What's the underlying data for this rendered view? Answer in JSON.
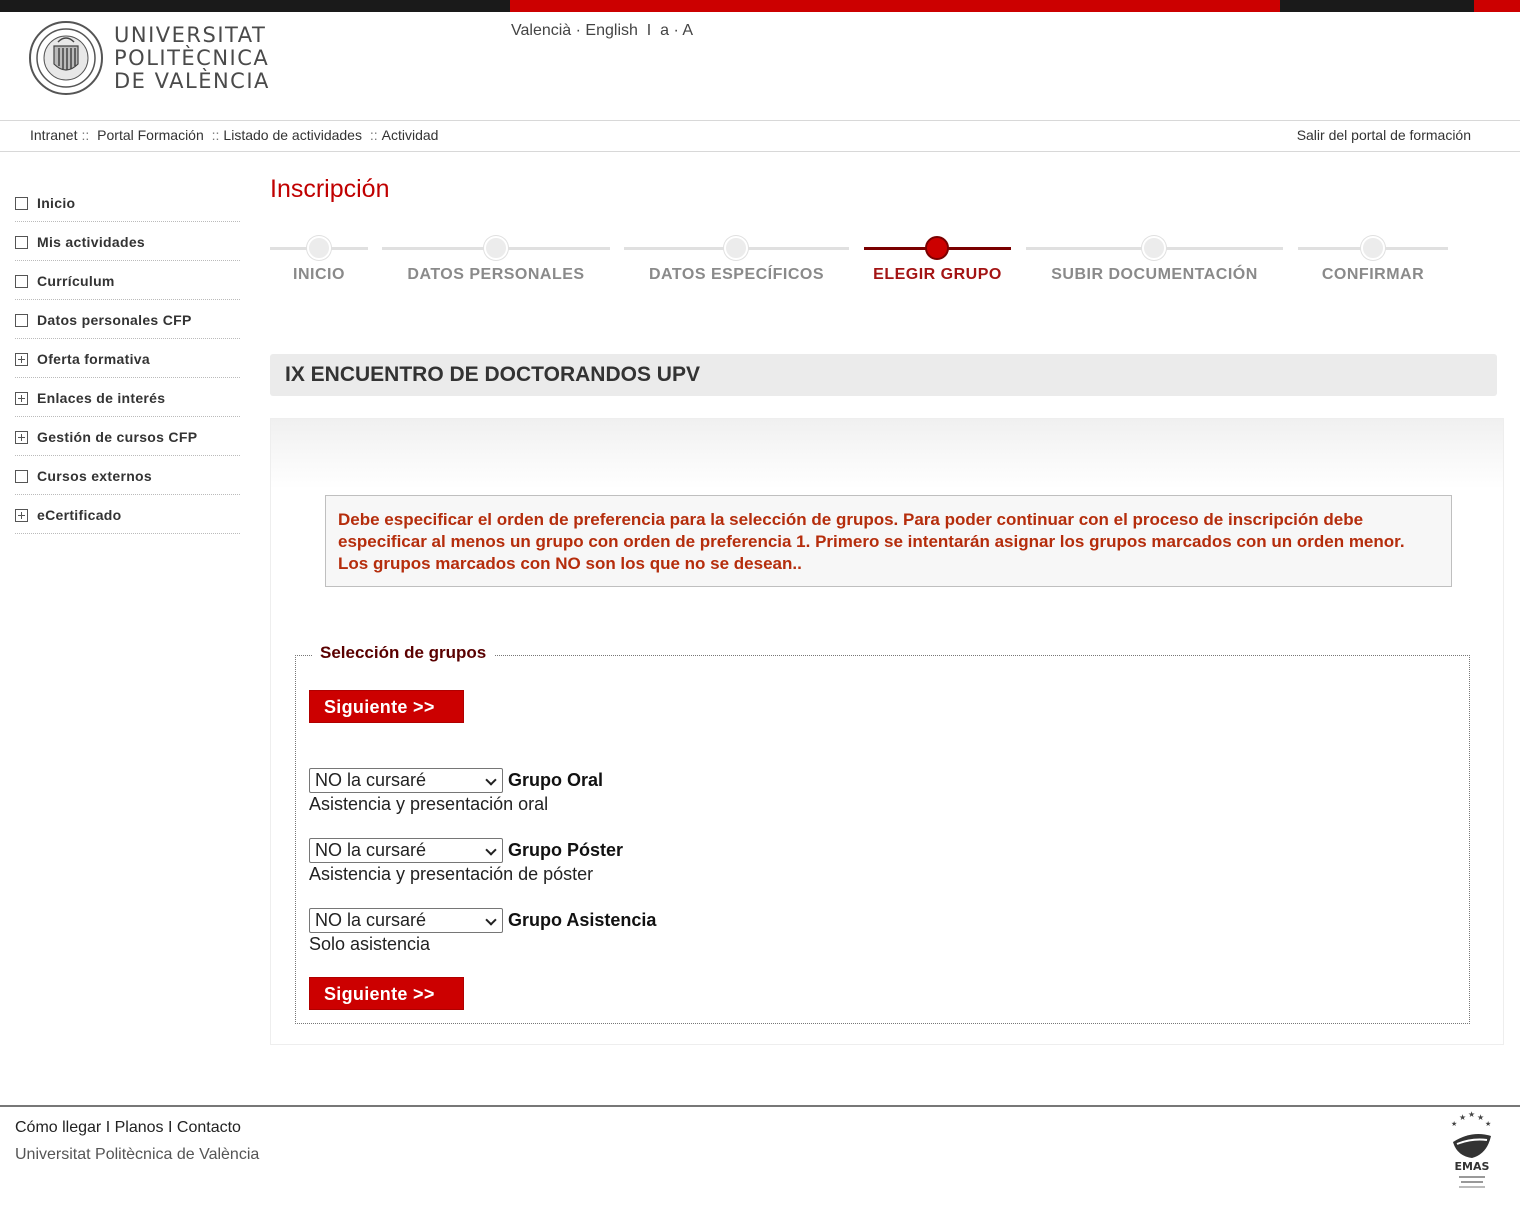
{
  "header": {
    "logo": {
      "line1": "UNIVERSITAT",
      "line2": "POLITÈCNICA",
      "line3": "DE VALÈNCIA"
    },
    "lang": {
      "valencia": "Valencià",
      "dot1": "·",
      "english": "English",
      "bar": "I",
      "small_a": "a",
      "dot2": "·",
      "big_a": "A"
    }
  },
  "breadcrumb": {
    "items": [
      "Intranet",
      "Portal Formación",
      "Listado de actividades",
      "Actividad"
    ],
    "sep": "::"
  },
  "logout": "Salir del portal de formación",
  "sidebar": {
    "items": [
      {
        "label": "Inicio",
        "expandable": false
      },
      {
        "label": "Mis actividades",
        "expandable": false
      },
      {
        "label": "Currículum",
        "expandable": false
      },
      {
        "label": "Datos personales CFP",
        "expandable": false
      },
      {
        "label": "Oferta formativa",
        "expandable": true
      },
      {
        "label": "Enlaces de interés",
        "expandable": true
      },
      {
        "label": "Gestión de cursos CFP",
        "expandable": true
      },
      {
        "label": "Cursos externos",
        "expandable": false
      },
      {
        "label": "eCertificado",
        "expandable": true
      }
    ]
  },
  "page_title": "Inscripción",
  "steps": [
    {
      "label": "INICIO",
      "active": false
    },
    {
      "label": "DATOS PERSONALES",
      "active": false
    },
    {
      "label": "DATOS ESPECÍFICOS",
      "active": false
    },
    {
      "label": "ELEGIR GRUPO",
      "active": true
    },
    {
      "label": "SUBIR DOCUMENTACIÓN",
      "active": false
    },
    {
      "label": "CONFIRMAR",
      "active": false
    }
  ],
  "activity_title": "IX ENCUENTRO DE DOCTORANDOS UPV",
  "notice": "Debe especificar el orden de preferencia para la selección de grupos. Para poder continuar con el proceso de inscripción debe especificar al menos un grupo con orden de preferencia 1. Primero se intentarán asignar los grupos marcados con un orden menor. Los grupos marcados con NO son los que no se desean..",
  "selection": {
    "legend": "Selección de grupos",
    "next_label": "Siguiente >>",
    "groups": [
      {
        "selected": "NO la cursaré",
        "name": "Grupo Oral",
        "description": "Asistencia y presentación oral"
      },
      {
        "selected": "NO la cursaré",
        "name": "Grupo Póster",
        "description": "Asistencia y presentación de póster"
      },
      {
        "selected": "NO la cursaré",
        "name": "Grupo Asistencia",
        "description": "Solo asistencia"
      }
    ]
  },
  "footer": {
    "links": [
      "Cómo llegar",
      "Planos",
      "Contacto"
    ],
    "link_sep": "I",
    "name": "Universitat Politècnica de València",
    "emas_label": "EMAS"
  },
  "colors": {
    "brand_red": "#cc0000",
    "dark_red": "#7a0000",
    "notice_text": "#b52d0c"
  }
}
